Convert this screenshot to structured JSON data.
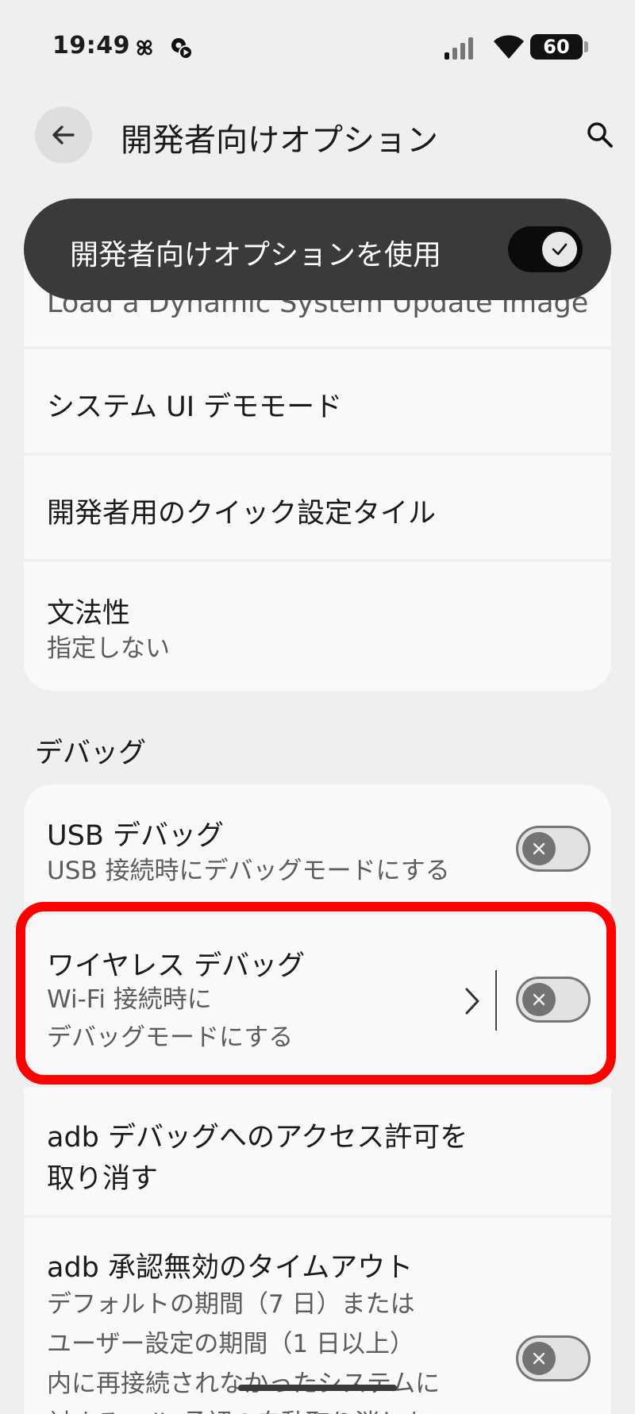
{
  "status_bar": {
    "time": "19:49",
    "battery": "60",
    "icons": [
      "pinwheel-icon",
      "gear-notification-icon",
      "signal-icon",
      "wifi-icon",
      "battery-icon"
    ]
  },
  "appbar": {
    "title": "開発者向けオプション",
    "back_icon": "back-arrow-icon",
    "search_icon": "search-icon"
  },
  "master_switch": {
    "label": "開発者向けオプションを使用",
    "state": "on"
  },
  "items_top": [
    {
      "title": "Load a Dynamic System Update Image"
    },
    {
      "title": "システム UI デモモード"
    },
    {
      "title": "開発者用のクイック設定タイル"
    },
    {
      "title": "文法性",
      "subtitle": "指定しない"
    }
  ],
  "debug_section": {
    "header": "デバッグ",
    "usb": {
      "title": "USB デバッグ",
      "subtitle": "USB 接続時にデバッグモードにする",
      "state": "off"
    },
    "wireless": {
      "title": "ワイヤレス デバッグ",
      "subtitle_line1": "Wi-Fi 接続時に",
      "subtitle_line2": "デバッグモードにする",
      "state": "off"
    },
    "revoke": {
      "line1": "adb デバッグへのアクセス許可を",
      "line2": "取り消す"
    },
    "timeout": {
      "title": "adb 承認無効のタイムアウト",
      "line1": "デフォルトの期間（7 日）または",
      "line2": "ユーザー設定の期間（1 日以上）",
      "line3": "内に再接続されなかったシステムに",
      "line4": "対する adb 承認の自動取り消しを",
      "state": "off"
    }
  },
  "colors": {
    "background": "#efefef",
    "card": "#f9f9f9",
    "highlight": "#ff0000",
    "master_bg": "#3a3a3a"
  }
}
